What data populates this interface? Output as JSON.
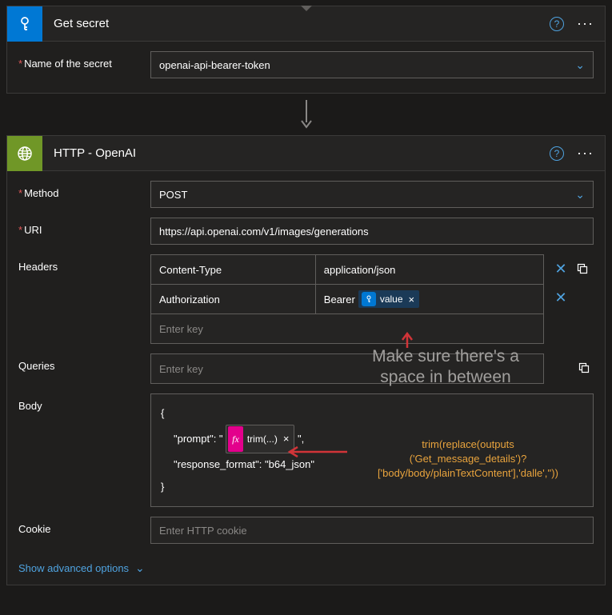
{
  "secret_card": {
    "title": "Get secret",
    "fields": {
      "name_label": "Name of the secret",
      "name_value": "openai-api-bearer-token"
    }
  },
  "http_card": {
    "title": "HTTP - OpenAI",
    "fields": {
      "method_label": "Method",
      "method_value": "POST",
      "uri_label": "URI",
      "uri_value": "https://api.openai.com/v1/images/generations",
      "headers_label": "Headers",
      "headers": {
        "row1_key": "Content-Type",
        "row1_val": "application/json",
        "row2_key": "Authorization",
        "row2_val_prefix": "Bearer ",
        "row2_token_label": "value",
        "new_key_placeholder": "Enter key"
      },
      "queries_label": "Queries",
      "queries_placeholder": "Enter key",
      "body_label": "Body",
      "body": {
        "open": "{",
        "prompt_key": "\"prompt\": \"",
        "fx_label": "trim(...)",
        "prompt_close": "\",",
        "response_format": "\"response_format\": \"b64_json\"",
        "close": "}"
      },
      "cookie_label": "Cookie",
      "cookie_placeholder": "Enter HTTP cookie"
    },
    "advanced_link": "Show advanced options"
  },
  "annotations": {
    "space_note_l1": "Make sure there's a",
    "space_note_l2": "space in between",
    "formula_l1": "trim(replace(outputs",
    "formula_l2": "('Get_message_details')?",
    "formula_l3": "['body/body/plainTextContent'],'dalle',''))"
  }
}
